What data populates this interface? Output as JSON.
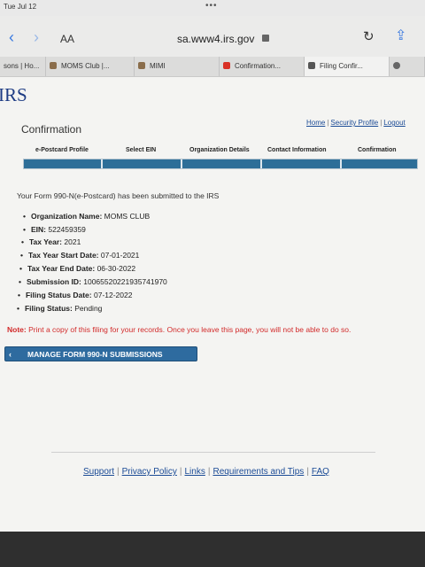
{
  "status_bar": {
    "time": "Tue Jul 12",
    "dots": "•••"
  },
  "browser": {
    "text_size_label": "AA",
    "url": "sa.www4.irs.gov",
    "tabs": [
      {
        "label": "sons | Ho..."
      },
      {
        "label": "MOMS Club |..."
      },
      {
        "label": "MIMI"
      },
      {
        "label": "Confirmation..."
      },
      {
        "label": "Filing Confir..."
      }
    ]
  },
  "header": {
    "logo": "IRS",
    "page_title": "Confirmation",
    "links": [
      "Home",
      "Security Profile",
      "Logout"
    ]
  },
  "steps": [
    "e-Postcard Profile",
    "Select EIN",
    "Organization Details",
    "Contact Information",
    "Confirmation"
  ],
  "intro": "Your Form 990-N(e-Postcard) has been submitted to the IRS",
  "details": [
    {
      "label": "Organization Name:",
      "value": "MOMS CLUB"
    },
    {
      "label": "EIN:",
      "value": "522459359"
    },
    {
      "label": "Tax Year:",
      "value": "2021"
    },
    {
      "label": "Tax Year Start Date:",
      "value": "07-01-2021"
    },
    {
      "label": "Tax Year End Date:",
      "value": "06-30-2022"
    },
    {
      "label": "Submission ID:",
      "value": "10065520221935741970"
    },
    {
      "label": "Filing Status Date:",
      "value": "07-12-2022"
    },
    {
      "label": "Filing Status:",
      "value": "Pending"
    }
  ],
  "note": {
    "label": "Note:",
    "text": "Print a copy of this filing for your records. Once you leave this page, you will not be able to do so."
  },
  "manage_button": "MANAGE FORM 990-N SUBMISSIONS",
  "footer_links": [
    "Support",
    "Privacy Policy",
    "Links",
    "Requirements and Tips",
    "FAQ"
  ]
}
